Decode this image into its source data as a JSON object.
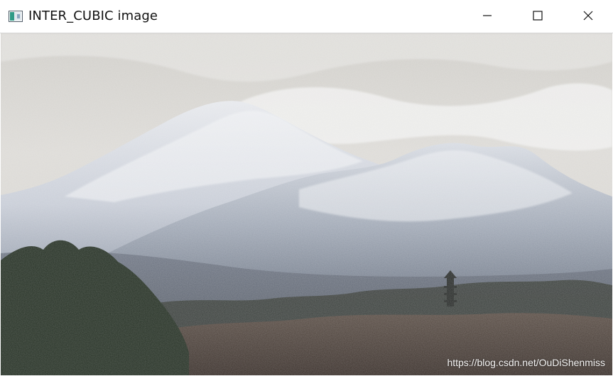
{
  "window": {
    "title": "INTER_CUBIC image",
    "icon": "image-window-icon",
    "controls": [
      "minimize-icon",
      "maximize-icon",
      "close-icon"
    ]
  },
  "image": {
    "watermark": "https://blog.csdn.net/OuDiShenmiss",
    "colors": {
      "sky": "#d6d4cf",
      "snow": "#e9ebef",
      "mountain_shadow": "#6f7684",
      "forest": "#2a3328",
      "warm_trees": "#6b5747"
    }
  }
}
